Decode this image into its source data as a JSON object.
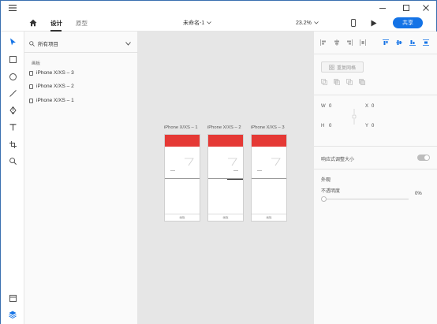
{
  "window": {
    "title": "未命名-1",
    "controls": [
      "minimize",
      "maximize",
      "close"
    ]
  },
  "toolbar": {
    "home_icon": "home-icon",
    "tabs": [
      {
        "label": "设计",
        "active": true
      },
      {
        "label": "原型",
        "active": false
      }
    ],
    "doc_title": "未命名-1",
    "zoom": "23.2%",
    "share_label": "共享"
  },
  "tools": [
    "select-icon",
    "rectangle-icon",
    "ellipse-icon",
    "line-icon",
    "pen-icon",
    "text-icon",
    "artboard-icon",
    "zoom-icon"
  ],
  "bottom_tools": [
    "assets-icon",
    "layers-icon"
  ],
  "layers": {
    "filter_label": "所有项目",
    "section_label": "画板",
    "items": [
      {
        "label": "iPhone X/XS – 3"
      },
      {
        "label": "iPhone X/XS – 2"
      },
      {
        "label": "iPhone X/XS – 1"
      }
    ]
  },
  "canvas": {
    "artboards": [
      {
        "label": "iPhone X/XS – 1",
        "footer": "画板"
      },
      {
        "label": "iPhone X/XS – 2",
        "footer": "画板"
      },
      {
        "label": "iPhone X/XS – 3",
        "footer": "画板"
      }
    ]
  },
  "inspector": {
    "repeat_grid_label": "重复网格",
    "w_label": "W",
    "w_value": "0",
    "h_label": "H",
    "h_value": "0",
    "x_label": "X",
    "x_value": "0",
    "y_label": "Y",
    "y_value": "0",
    "responsive_label": "响应式调整大小",
    "appearance_label": "外观",
    "opacity_label": "不透明度",
    "opacity_value": "0%"
  },
  "colors": {
    "accent": "#1473e6",
    "artboard_header": "#e53935",
    "canvas_bg": "#e6e6e6",
    "rail_active": "#1473e6"
  }
}
